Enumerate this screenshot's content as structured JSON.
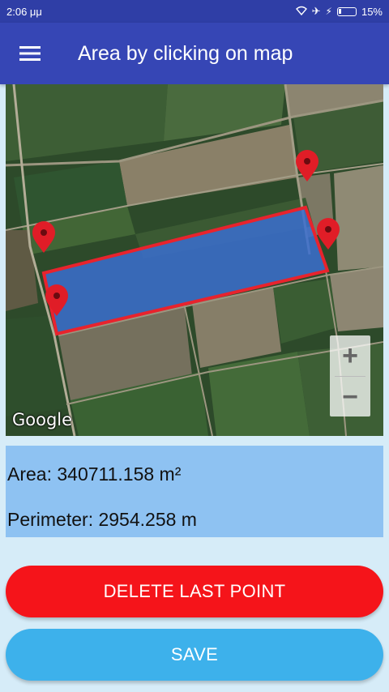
{
  "status_bar": {
    "time": "2:06 μμ",
    "battery": "15%"
  },
  "toolbar": {
    "title": "Area by clicking on map",
    "menu_icon": "hamburger-menu-icon"
  },
  "map": {
    "attribution": "Google",
    "zoom_in_label": "+",
    "zoom_out_label": "−",
    "polygon_fill": "#3b6fd0",
    "polygon_stroke": "#e8232d",
    "marker_color": "#e01d27"
  },
  "results": {
    "area": "Area: 340711.158 m²",
    "perimeter": "Perimeter: 2954.258 m"
  },
  "buttons": {
    "delete_label": "DELETE LAST POINT",
    "save_label": "SAVE"
  },
  "colors": {
    "primary": "#3646b5",
    "delete": "#f5141a",
    "save": "#3db1eb",
    "panel": "#8ec2f2"
  }
}
